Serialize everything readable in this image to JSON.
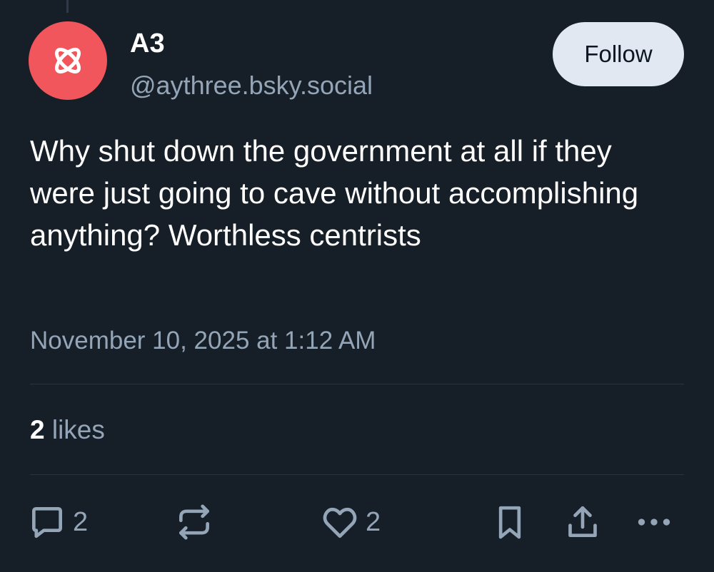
{
  "author": {
    "display_name": "A3",
    "handle": "@aythree.bsky.social",
    "avatar_icon": "atom-logo-icon",
    "avatar_color": "#f0565c"
  },
  "follow_button": {
    "label": "Follow"
  },
  "post": {
    "text": "Why shut down the government at all if they were just going to cave without accomplishing anything? Worthless centrists",
    "timestamp": "November 10, 2025 at 1:12 AM"
  },
  "stats": {
    "likes_count": "2",
    "likes_label": "likes"
  },
  "actions": {
    "reply": {
      "icon": "speech-bubble-icon",
      "count": "2"
    },
    "repost": {
      "icon": "repost-arrows-icon"
    },
    "like": {
      "icon": "heart-icon",
      "count": "2"
    },
    "bookmark": {
      "icon": "bookmark-icon"
    },
    "share": {
      "icon": "share-upload-icon"
    },
    "more": {
      "icon": "ellipsis-icon"
    }
  },
  "colors": {
    "background": "#161e27",
    "primary_text": "#ffffff",
    "secondary_text": "#93a5b7",
    "follow_button_bg": "#e1e8f1",
    "divider": "#28333f"
  }
}
